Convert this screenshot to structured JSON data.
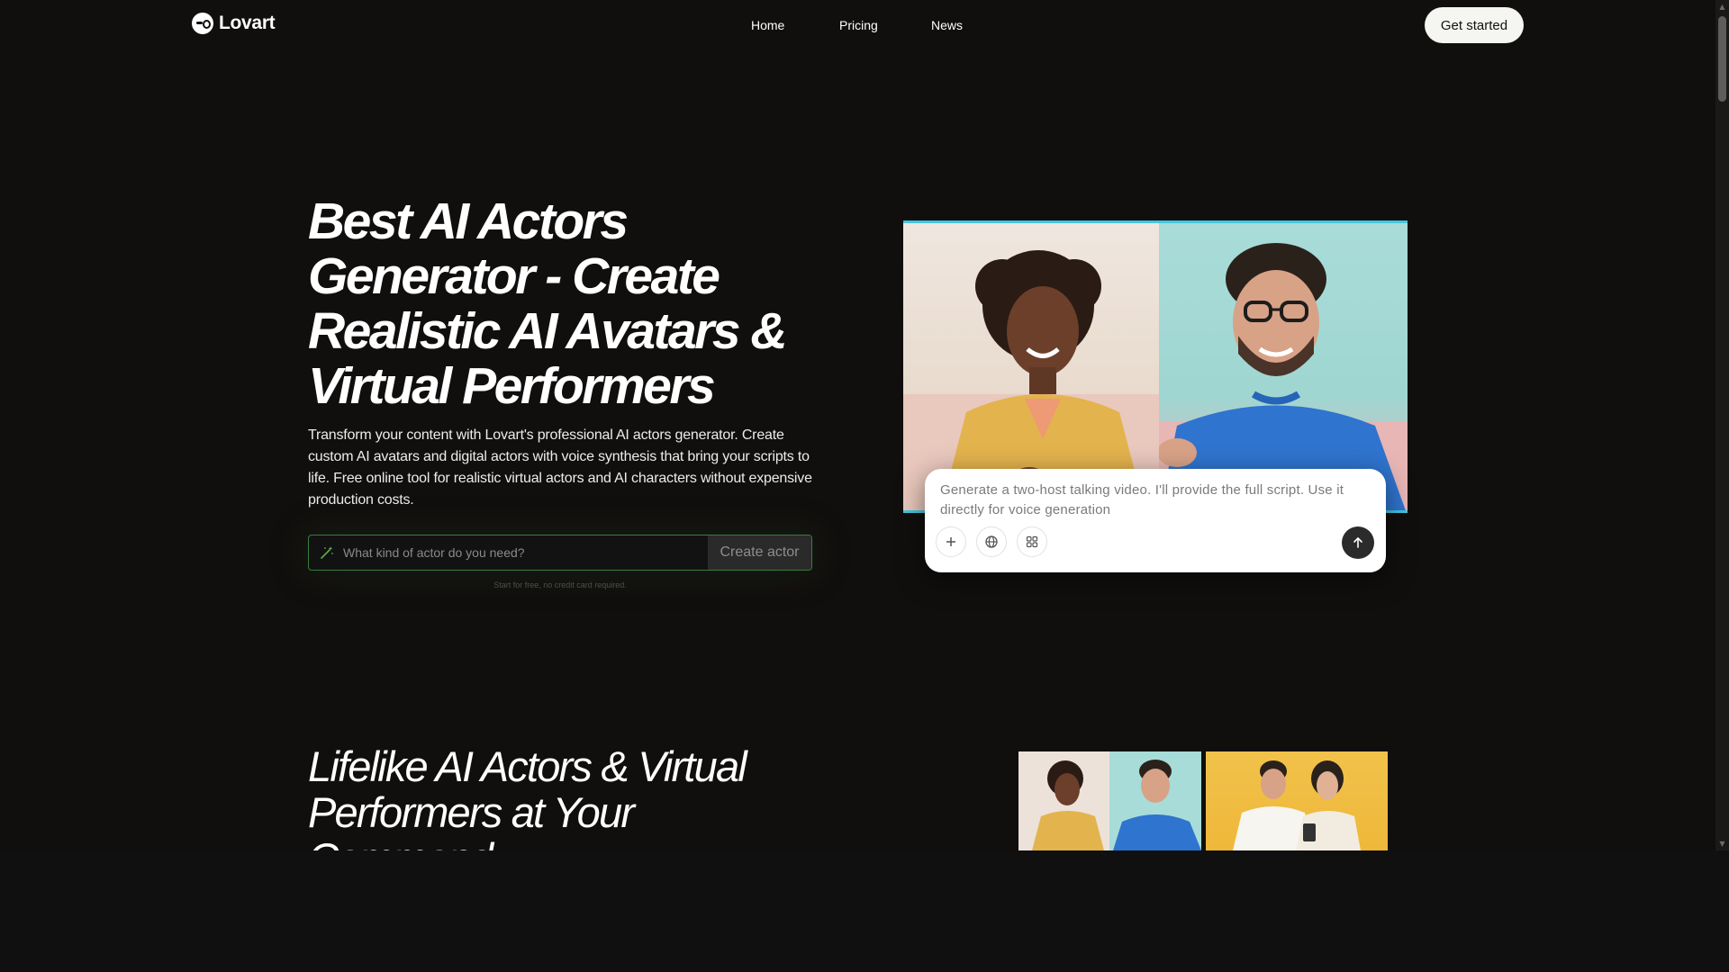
{
  "brand": {
    "name": "Lovart"
  },
  "nav": {
    "home": "Home",
    "pricing": "Pricing",
    "news": "News"
  },
  "header": {
    "cta": "Get started"
  },
  "hero": {
    "title_lines": [
      "Best AI Actors",
      "Generator - Create",
      "Realistic AI Avatars &",
      "Virtual Performers"
    ],
    "description": "Transform your content with Lovart's professional AI actors generator. Create custom AI avatars and digital actors with voice synthesis that bring your scripts to life. Free online tool for realistic virtual actors and AI characters without expensive production costs.",
    "search_placeholder": "What kind of actor do you need?",
    "create_button": "Create actor",
    "hint": "Start for free, no credit card required."
  },
  "chat": {
    "prompt_text": "Generate a two-host talking video. I'll provide the full script. Use it directly for voice generation"
  },
  "section2": {
    "title_lines": [
      "Lifelike AI Actors & Virtual",
      "Performers at Your",
      "Command"
    ]
  },
  "colors": {
    "background": "#110f0d",
    "accent_cyan": "#44c6e0",
    "input_border": "#3a7d3a"
  }
}
